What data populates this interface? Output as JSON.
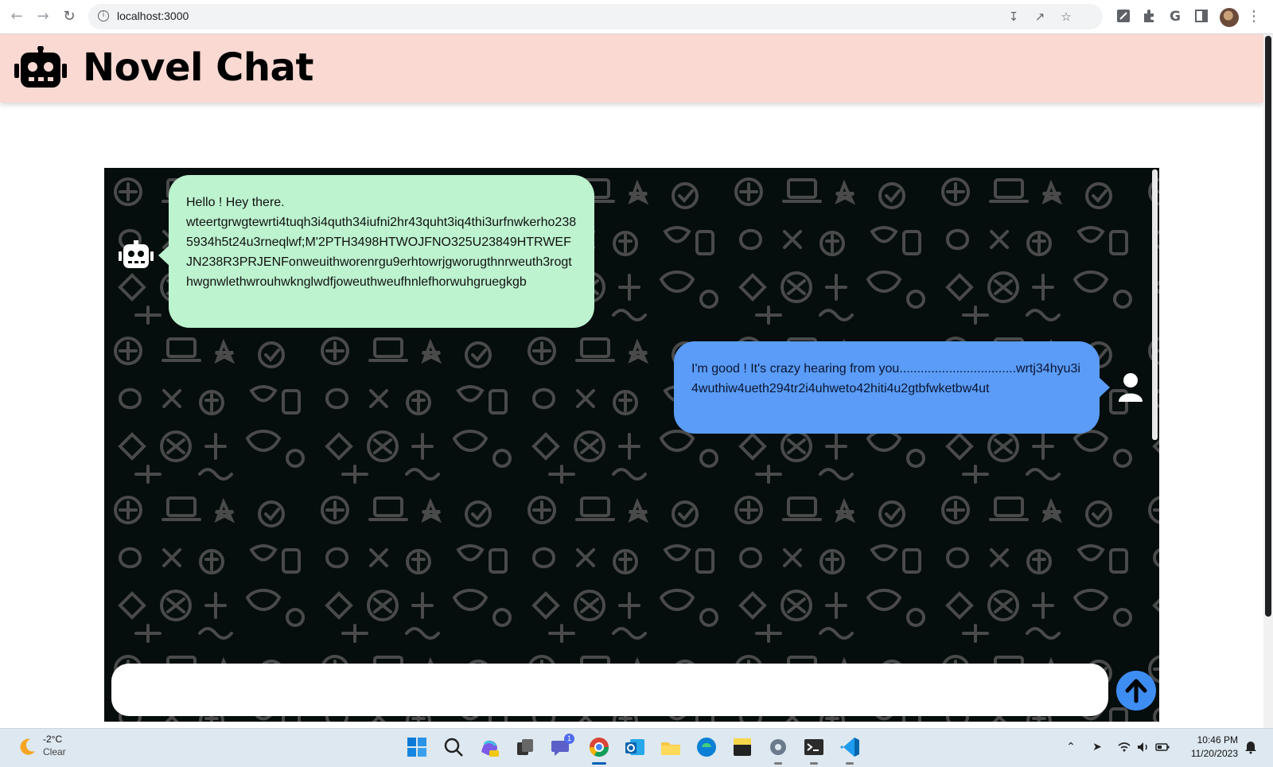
{
  "browser": {
    "url": "localhost:3000",
    "icons": [
      "back-icon",
      "forward-icon",
      "reload-icon",
      "site-info-icon",
      "install-icon",
      "share-icon",
      "bookmark-star-icon",
      "extension-icon",
      "puzzle-icon",
      "g-extension-icon",
      "side-panel-icon",
      "profile-avatar",
      "menu-icon"
    ]
  },
  "header": {
    "title": "Novel Chat",
    "background": "#f9d9d2"
  },
  "chat": {
    "background": "#050d0d",
    "messages": [
      {
        "sender": "bot",
        "bubble_color": "#bdf3cf",
        "line1": "Hello ! Hey there.",
        "line2": "wteertgrwgtewrti4tuqh3i4quth34iufni2hr43quht3iq4thi3urfnwkerho2385934h5t24u3rneqlwf;M'2PTH3498HTWOJFNO325U23849HTRWEFJN238R3PRJENFonweuithworenrgu9erhtowrjgworugthnrweuth3rogthwgnwlethwrouhwknglwdfjoweuthweufhnlefhorwuhgruegkgb"
      },
      {
        "sender": "user",
        "bubble_color": "#5a9cf7",
        "line1": "I'm good ! It's crazy hearing from you.................................wrtj34hyu3i4wuthiw4ueth294tr2i4uhweto42hiti4u2gtbfwketbw4ut"
      }
    ],
    "input_value": "",
    "send_button_color": "#3e8df2"
  },
  "taskbar": {
    "weather": {
      "temp": "-2°C",
      "condition": "Clear"
    },
    "apps": [
      "start-icon",
      "search-icon",
      "copilot-icon",
      "task-view-icon",
      "teams-chat-icon",
      "chrome-icon",
      "outlook-icon",
      "file-explorer-icon",
      "edge-icon",
      "sticky-notes-icon",
      "settings-icon",
      "terminal-icon",
      "vscode-icon"
    ],
    "chat_badge": "1",
    "time": "10:46 PM",
    "date": "11/20/2023"
  }
}
